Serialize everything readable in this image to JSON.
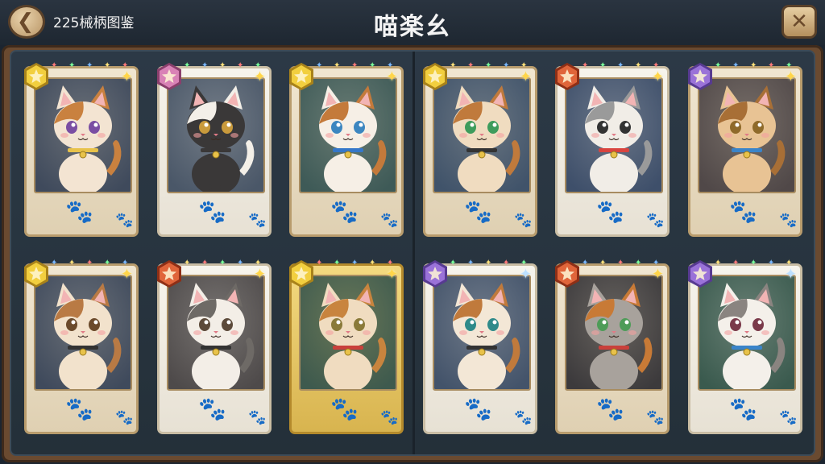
{
  "header": {
    "count_label": "225械柄图鉴",
    "title": "喵楽幺",
    "back_icon": "back-arrow-icon",
    "close_icon": "close-icon"
  },
  "colors": {
    "panel": "#2c3946",
    "frame": "#6a4a30",
    "card": "#f0e6d1"
  },
  "cards": [
    {
      "badge": "gold",
      "badge_letter": "★",
      "bg": "#3f4a5c",
      "fur": "#f3e4d2",
      "patch": "#c9813f",
      "eye": "#7a4ea3",
      "collar": "#e8c24a",
      "frame": "normal",
      "star": "gold"
    },
    {
      "badge": "pink",
      "badge_letter": "★",
      "bg": "#4a5768",
      "fur": "#3a3838",
      "patch": "#f3efe8",
      "eye": "#c99a3c",
      "collar": "#3a3838",
      "frame": "white",
      "star": "gold"
    },
    {
      "badge": "gold",
      "badge_letter": "★",
      "bg": "#3e5a57",
      "fur": "#f6efe6",
      "patch": "#c47a3b",
      "eye": "#3c86c0",
      "collar": "#3577c9",
      "frame": "normal",
      "star": "gold"
    },
    {
      "badge": "gold",
      "badge_letter": "★",
      "bg": "#40536a",
      "fur": "#f0dcc0",
      "patch": "#c07a3c",
      "eye": "#3e9c5c",
      "collar": "#333",
      "frame": "normal",
      "star": "gold"
    },
    {
      "badge": "red",
      "badge_letter": "★",
      "bg": "#3e4f6a",
      "fur": "#f1ede7",
      "patch": "#9a9a9a",
      "eye": "#333",
      "collar": "#d9443f",
      "frame": "white",
      "star": "gold"
    },
    {
      "badge": "purple",
      "badge_letter": "★",
      "bg": "#504848",
      "fur": "#e8c394",
      "patch": "#a86f36",
      "eye": "#8f6a2a",
      "collar": "#3a84c9",
      "frame": "normal",
      "star": "gold"
    },
    {
      "badge": "gold",
      "badge_letter": "★",
      "bg": "#3f4a5c",
      "fur": "#f2e2cc",
      "patch": "#b97a44",
      "eye": "#6b4a2b",
      "collar": "#333",
      "frame": "normal",
      "star": "gold"
    },
    {
      "badge": "red",
      "badge_letter": "★",
      "bg": "#4e4a4a",
      "fur": "#f3eee7",
      "patch": "#6e6a66",
      "eye": "#5c4a3a",
      "collar": "#333",
      "frame": "white",
      "star": "gold"
    },
    {
      "badge": "gold",
      "badge_letter": "★",
      "bg": "#3e5a4e",
      "fur": "#f0dcc0",
      "patch": "#c8843e",
      "eye": "#8a7a3a",
      "collar": "#c9403b",
      "frame": "gold",
      "star": "gold"
    },
    {
      "badge": "purple",
      "badge_letter": "★",
      "bg": "#43536a",
      "fur": "#f3e7d6",
      "patch": "#c07a3c",
      "eye": "#2e8a8a",
      "collar": "#333",
      "frame": "white",
      "star": "blue"
    },
    {
      "badge": "red",
      "badge_letter": "★",
      "bg": "#3c3a3c",
      "fur": "#a8a29c",
      "patch": "#c87a36",
      "eye": "#4e9c58",
      "collar": "#c9403b",
      "frame": "normal",
      "star": "gold"
    },
    {
      "badge": "purple",
      "badge_letter": "★",
      "bg": "#3a5a4e",
      "fur": "#f4f0ea",
      "patch": "#8a8480",
      "eye": "#7a3a4a",
      "collar": "#3a84c9",
      "frame": "white",
      "star": "blue"
    }
  ]
}
